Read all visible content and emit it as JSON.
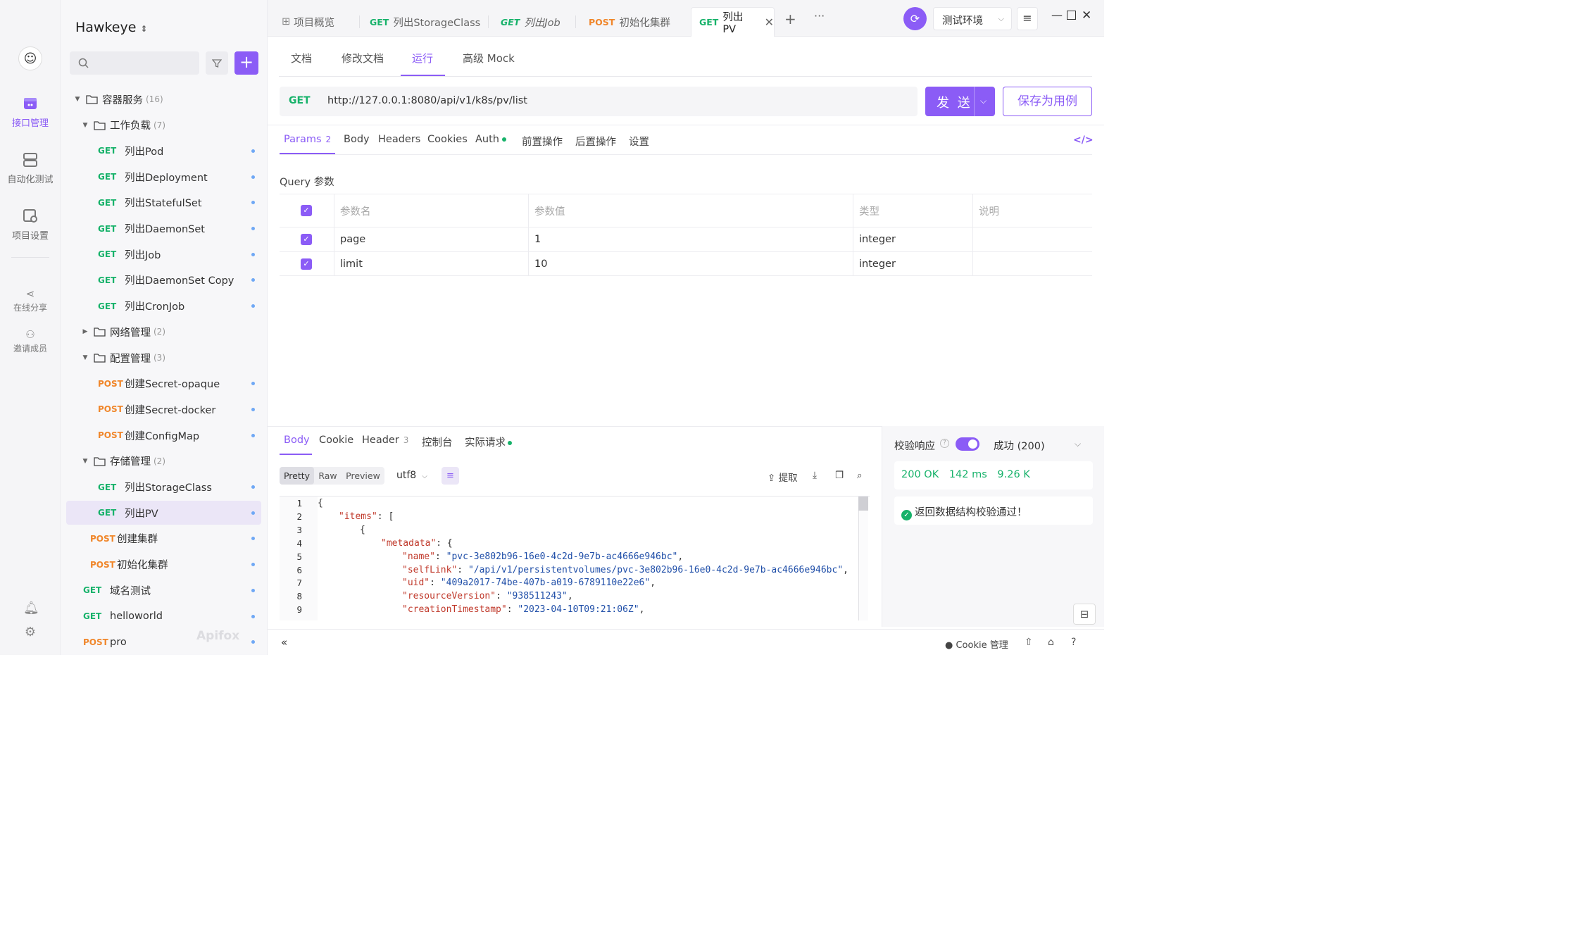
{
  "rail": {
    "items": [
      {
        "label": "接口管理"
      },
      {
        "label": "自动化测试"
      },
      {
        "label": "项目设置"
      }
    ],
    "share_label": "在线分享",
    "invite_label": "邀请成员"
  },
  "sidebar": {
    "project": "Hawkeye",
    "tree": [
      {
        "type": "folder",
        "name": "容器服务",
        "count": "(16)",
        "expanded": true
      },
      {
        "type": "folder",
        "name": "工作负载",
        "count": "(7)",
        "expanded": true
      },
      {
        "type": "api",
        "method": "GET",
        "name": "列出Pod"
      },
      {
        "type": "api",
        "method": "GET",
        "name": "列出Deployment"
      },
      {
        "type": "api",
        "method": "GET",
        "name": "列出StatefulSet"
      },
      {
        "type": "api",
        "method": "GET",
        "name": "列出DaemonSet"
      },
      {
        "type": "api",
        "method": "GET",
        "name": "列出Job"
      },
      {
        "type": "api",
        "method": "GET",
        "name": "列出DaemonSet Copy"
      },
      {
        "type": "api",
        "method": "GET",
        "name": "列出CronJob"
      },
      {
        "type": "folder",
        "name": "网络管理",
        "count": "(2)",
        "expanded": false
      },
      {
        "type": "folder",
        "name": "配置管理",
        "count": "(3)",
        "expanded": true
      },
      {
        "type": "api",
        "method": "POST",
        "name": "创建Secret-opaque"
      },
      {
        "type": "api",
        "method": "POST",
        "name": "创建Secret-docker"
      },
      {
        "type": "api",
        "method": "POST",
        "name": "创建ConfigMap"
      },
      {
        "type": "folder",
        "name": "存储管理",
        "count": "(2)",
        "expanded": true
      },
      {
        "type": "api",
        "method": "GET",
        "name": "列出StorageClass"
      },
      {
        "type": "api",
        "method": "GET",
        "name": "列出PV",
        "selected": true
      },
      {
        "type": "api",
        "method": "POST",
        "name": "创建集群"
      },
      {
        "type": "api",
        "method": "POST",
        "name": "初始化集群"
      },
      {
        "type": "api",
        "method": "GET",
        "name": "域名测试"
      },
      {
        "type": "api",
        "method": "GET",
        "name": "helloworld"
      },
      {
        "type": "api",
        "method": "POST",
        "name": "pro"
      }
    ],
    "watermark": "Apifox"
  },
  "tabs": [
    {
      "method": "",
      "label": "项目概览"
    },
    {
      "method": "GET",
      "label": "列出StorageClass"
    },
    {
      "method": "GET",
      "label": "列出Job"
    },
    {
      "method": "POST",
      "label": "初始化集群"
    },
    {
      "method": "GET",
      "label": "列出PV",
      "active": true
    }
  ],
  "env": {
    "label": "测试环境"
  },
  "doc_tabs": [
    "文档",
    "修改文档",
    "运行",
    "高级 Mock"
  ],
  "request": {
    "method": "GET",
    "url": "http://127.0.0.1:8080/api/v1/k8s/pv/list",
    "send_label": "发 送",
    "save_label": "保存为用例"
  },
  "param_tabs": [
    {
      "label": "Params",
      "badge": "2"
    },
    {
      "label": "Body",
      "badge": ""
    },
    {
      "label": "Headers",
      "badge": ""
    },
    {
      "label": "Cookies",
      "badge": ""
    },
    {
      "label": "Auth",
      "badge": ""
    },
    {
      "label": "前置操作",
      "badge": ""
    },
    {
      "label": "后置操作",
      "badge": ""
    },
    {
      "label": "设置",
      "badge": ""
    }
  ],
  "query": {
    "label": "Query 参数",
    "headers": [
      "参数名",
      "参数值",
      "类型",
      "说明"
    ],
    "rows": [
      {
        "name": "page",
        "value": "1",
        "type": "integer",
        "desc": ""
      },
      {
        "name": "limit",
        "value": "10",
        "type": "integer",
        "desc": ""
      }
    ]
  },
  "response": {
    "tabs": [
      {
        "label": "Body",
        "badge": ""
      },
      {
        "label": "Cookie",
        "badge": ""
      },
      {
        "label": "Header",
        "badge": "3"
      },
      {
        "label": "控制台",
        "badge": ""
      },
      {
        "label": "实际请求",
        "badge": ""
      }
    ],
    "formats": [
      "Pretty",
      "Raw",
      "Preview"
    ],
    "encoding": "utf8",
    "extract_label": "提取",
    "lines": [
      {
        "n": "1",
        "indent": 0,
        "key": "",
        "val": "",
        "raw": "{"
      },
      {
        "n": "2",
        "indent": 1,
        "key": "\"items\"",
        "val": "",
        "raw": ": ["
      },
      {
        "n": "3",
        "indent": 2,
        "key": "",
        "val": "",
        "raw": "{"
      },
      {
        "n": "4",
        "indent": 3,
        "key": "\"metadata\"",
        "val": "",
        "raw": ": {"
      },
      {
        "n": "5",
        "indent": 4,
        "key": "\"name\"",
        "val": "\"pvc-3e802b96-16e0-4c2d-9e7b-ac4666e946bc\"",
        "raw": ","
      },
      {
        "n": "6",
        "indent": 4,
        "key": "\"selfLink\"",
        "val": "\"/api/v1/persistentvolumes/pvc-3e802b96-16e0-4c2d-9e7b-ac4666e946bc\"",
        "raw": ","
      },
      {
        "n": "7",
        "indent": 4,
        "key": "\"uid\"",
        "val": "\"409a2017-74be-407b-a019-6789110e22e6\"",
        "raw": ","
      },
      {
        "n": "8",
        "indent": 4,
        "key": "\"resourceVersion\"",
        "val": "\"938511243\"",
        "raw": ","
      },
      {
        "n": "9",
        "indent": 4,
        "key": "\"creationTimestamp\"",
        "val": "\"2023-04-10T09:21:06Z\"",
        "raw": ","
      }
    ]
  },
  "validation": {
    "label": "校验响应",
    "status": "成功 (200)",
    "code": "200 OK",
    "time": "142 ms",
    "size": "9.26 K",
    "message": "返回数据结构校验通过！"
  },
  "footer": {
    "cookie_label": "Cookie 管理"
  },
  "colors": {
    "accent": "#8b5cf6",
    "get": "#17b26a",
    "post": "#f0862a"
  }
}
